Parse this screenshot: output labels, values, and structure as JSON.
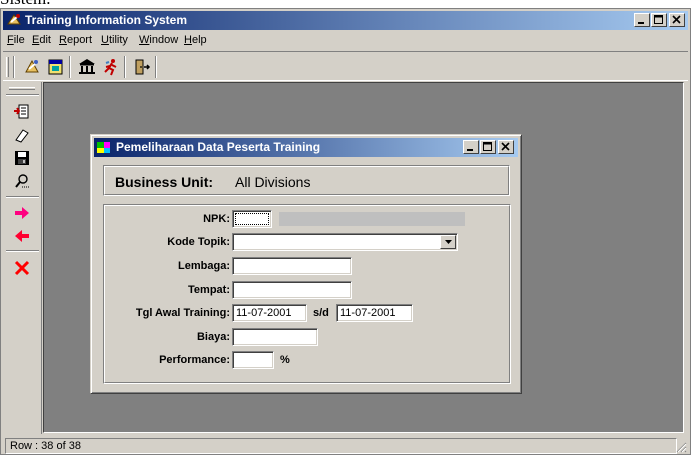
{
  "document_caption": "Sistem.",
  "window": {
    "title": "Training Information System"
  },
  "menu": {
    "items": [
      {
        "label": "File",
        "underline": "F",
        "rest": "ile"
      },
      {
        "label": "Edit",
        "underline": "E",
        "rest": "dit"
      },
      {
        "label": "Report",
        "underline": "R",
        "rest": "eport"
      },
      {
        "label": "Utility",
        "underline": "U",
        "rest": "tility"
      },
      {
        "label": "Window",
        "underline": "W",
        "rest": "indow"
      },
      {
        "label": "Help",
        "underline": "H",
        "rest": "elp"
      }
    ]
  },
  "toolbar": {
    "icons": [
      "training-icon",
      "calendar-icon",
      "institution-icon",
      "runner-icon",
      "exit-door-icon"
    ]
  },
  "side_toolbar": {
    "icons": [
      "new-record-icon",
      "edit-eraser-icon",
      "save-disk-icon",
      "search-icon",
      "next-arrow-icon",
      "previous-arrow-icon",
      "delete-x-icon"
    ]
  },
  "child_window": {
    "title": "Pemeliharaan Data Peserta Training",
    "business_unit_label": "Business Unit:",
    "business_unit_value": "All Divisions"
  },
  "form": {
    "npk_label": "NPK:",
    "npk_value": "",
    "kode_topik_label": "Kode Topik:",
    "kode_topik_value": "",
    "lembaga_label": "Lembaga:",
    "lembaga_value": "",
    "tempat_label": "Tempat:",
    "tempat_value": "",
    "tgl_awal_label": "Tgl Awal Training:",
    "tgl_awal_value": "11-07-2001",
    "sd_label": "s/d",
    "tgl_akhir_value": "11-07-2001",
    "biaya_label": "Biaya:",
    "biaya_value": "",
    "performance_label": "Performance:",
    "performance_value": "",
    "percent_label": "%"
  },
  "statusbar": {
    "text": "Row : 38 of 38"
  },
  "colors": {
    "titlebar_start": "#0a246a",
    "titlebar_end": "#a6caf0",
    "face": "#d4d0c8",
    "mdi_background": "#808080"
  }
}
